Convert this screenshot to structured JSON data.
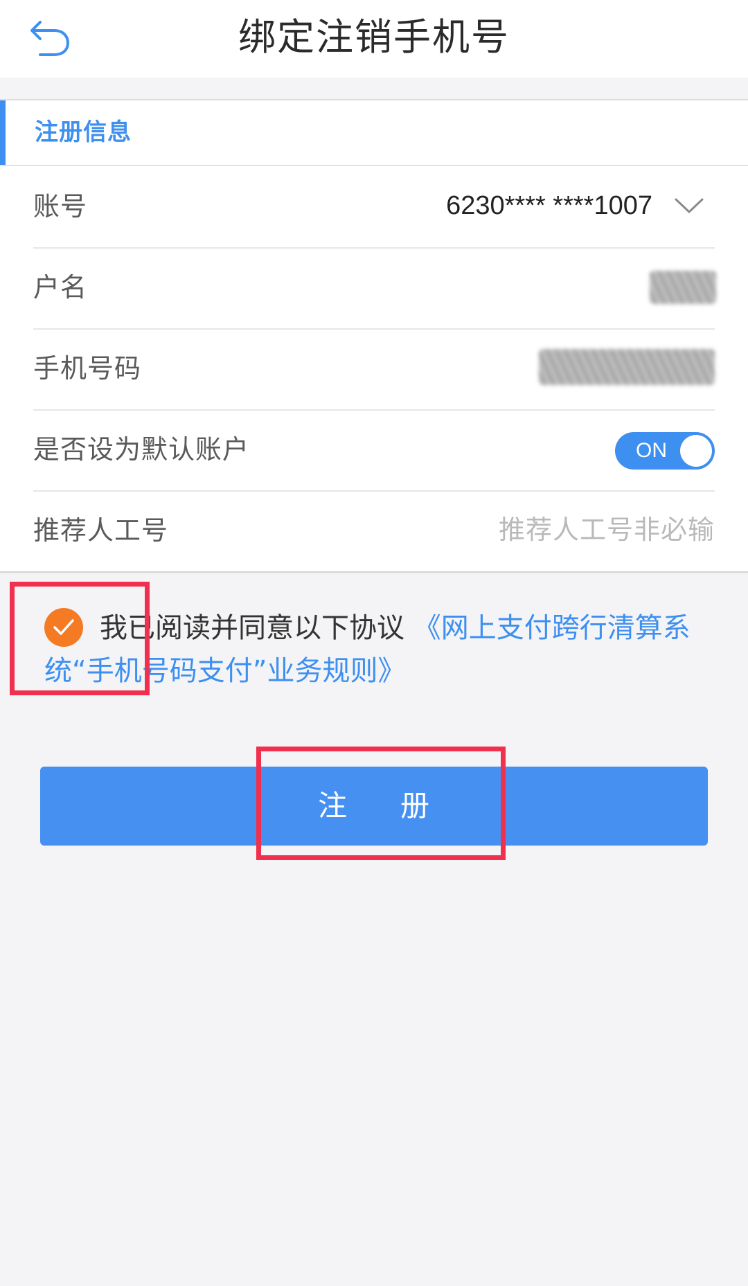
{
  "header": {
    "title": "绑定注销手机号",
    "back_icon": "back-arrow-icon"
  },
  "section": {
    "title": "注册信息"
  },
  "form": {
    "account": {
      "label": "账号",
      "value": "6230**** ****1007",
      "icon": "chevron-down-icon"
    },
    "name": {
      "label": "户名"
    },
    "phone": {
      "label": "手机号码"
    },
    "default_account": {
      "label": "是否设为默认账户",
      "toggle_label": "ON",
      "toggle_on": true
    },
    "referrer": {
      "label": "推荐人工号",
      "placeholder": "推荐人工号非必输"
    }
  },
  "agreement": {
    "checked": true,
    "text": "我已阅读并同意以下协议 ",
    "link_text": "《网上支付跨行清算系统“手机号码支付”业务规则》"
  },
  "submit": {
    "label": "注      册"
  },
  "colors": {
    "accent": "#3d8ff0",
    "checkbox": "#f47a24",
    "highlight": "#f0304e",
    "button": "#4690f1"
  }
}
